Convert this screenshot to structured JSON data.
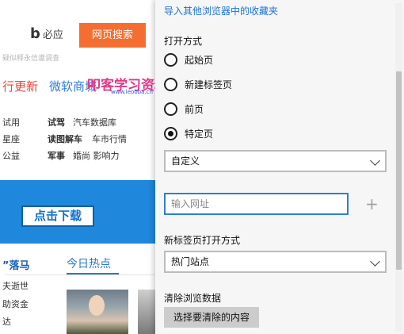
{
  "background_page": {
    "search": {
      "engine_label": "必应",
      "button_label": "网页搜索",
      "hint": "疑似释永信遭调查"
    },
    "headlines": {
      "red": "行更新",
      "blue": "微软商城"
    },
    "watermark": {
      "main": "叩客学习资料网",
      "sub": "www.leobba.cn"
    },
    "links": {
      "col1": [
        "试用",
        "星座",
        "公益"
      ],
      "col2_bold": [
        "试驾",
        "读图解车",
        "军事"
      ],
      "col2_rest": [
        "汽车数据库",
        "车市行情",
        "婚尚 影响力"
      ]
    },
    "download_button": "点击下载",
    "news": {
      "title": "”落马",
      "hot_tab": "今日热点",
      "items": [
        "夫逝世",
        "助资金",
        "达"
      ]
    }
  },
  "settings": {
    "import_link": "导入其他浏览器中的收藏夹",
    "open_with": {
      "heading": "打开方式",
      "options": [
        {
          "label": "起始页",
          "checked": false
        },
        {
          "label": "新建标签页",
          "checked": false
        },
        {
          "label": "前页",
          "checked": false
        },
        {
          "label": "特定页",
          "checked": true
        }
      ],
      "select_value": "自定义"
    },
    "url_input": {
      "placeholder": "输入网址",
      "value": ""
    },
    "new_tab": {
      "heading": "新标签页打开方式",
      "select_value": "热门站点"
    },
    "clear_data": {
      "heading": "清除浏览数据",
      "button_label": "选择要清除的内容"
    }
  },
  "colors": {
    "accent": "#1a73d9",
    "search_button": "#f46e32",
    "banner": "#1f88dc",
    "pane_bg": "#f6f6f6"
  }
}
